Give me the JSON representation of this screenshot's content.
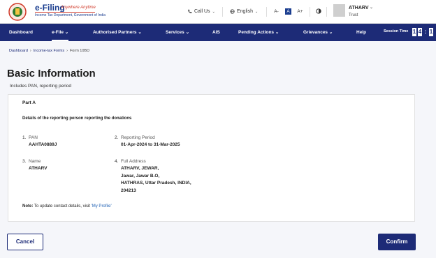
{
  "header": {
    "logo_title": "e-Filing",
    "logo_tagline": "Anywhere Anytime",
    "logo_subtitle": "Income Tax Department, Government of India",
    "call_us": "Call Us",
    "language": "English",
    "font_decrease": "A-",
    "font_normal": "A",
    "font_increase": "A+",
    "user_name": "ATHARV",
    "user_role": "Trust"
  },
  "nav": {
    "items": [
      "Dashboard",
      "e-File",
      "Authorised Partners",
      "Services",
      "AIS",
      "Pending Actions",
      "Grievances",
      "Help"
    ],
    "session_label": "Session Time",
    "timer_digits": [
      "1",
      "4",
      ":",
      "1"
    ]
  },
  "breadcrumb": [
    "Dashboard",
    "Income-tax Forms",
    "Form 10BD"
  ],
  "page": {
    "title": "Basic Information",
    "subtitle": "Includes PAN, reporting period"
  },
  "card": {
    "part": "Part A",
    "heading": "Details of the reporting person reporting the donations",
    "fields": [
      {
        "num": "1.",
        "label": "PAN",
        "value": "AAHTA0889J"
      },
      {
        "num": "2.",
        "label": "Reporting Period",
        "value": "01-Apr-2024 to 31-Mar-2025"
      },
      {
        "num": "3.",
        "label": "Name",
        "value": "ATHARV"
      },
      {
        "num": "4.",
        "label": "Full Address",
        "value_lines": [
          "ATHARV, JEWAR,",
          "Jawar, Jawar B.O,",
          "HATHRAS, Uttar Pradesh, INDIA,",
          "204213"
        ]
      }
    ],
    "note_label": "Note:",
    "note_text": " To update contact details, visit ",
    "note_link": "'My Profile'"
  },
  "buttons": {
    "cancel": "Cancel",
    "confirm": "Confirm"
  },
  "colors": {
    "nav_bg": "#1d2b77",
    "primary": "#1d2b77",
    "link": "#1d5fb4",
    "brand_red": "#d03a2a"
  }
}
